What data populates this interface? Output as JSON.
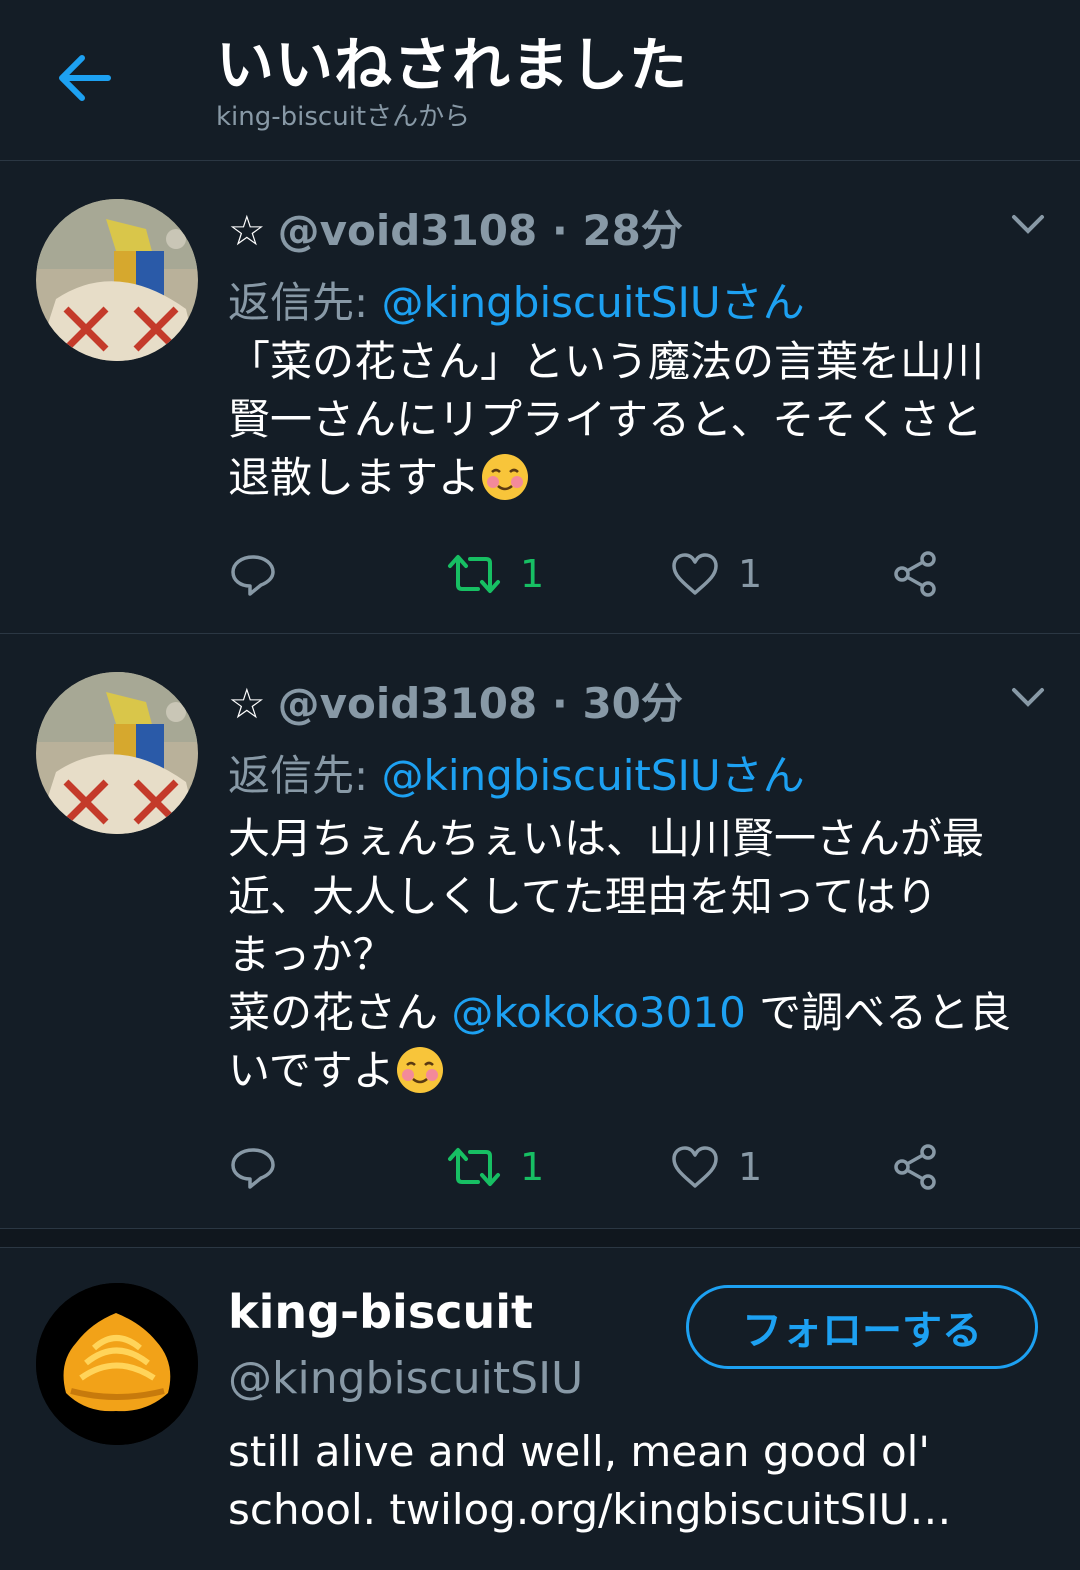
{
  "header": {
    "title": "いいねされました",
    "subtitle": "king-biscuitさんから",
    "back_icon": "arrow-left-icon"
  },
  "colors": {
    "background": "#141d26",
    "accent": "#1da1f2",
    "retweet_green": "#17bf63",
    "muted": "#8899a6"
  },
  "tweets": [
    {
      "star": "☆",
      "handle_time": "@void3108 · 28分",
      "reply_prefix": "返信先: ",
      "reply_target": "@kingbiscuitSIUさん",
      "text_lines": [
        "「菜の花さん」という魔法の言葉を山川",
        "賢一さんにリプライすると、そそくさと",
        "退散しますよ"
      ],
      "emoji": "smiling-face-icon",
      "retweets": "1",
      "likes": "1"
    },
    {
      "star": "☆",
      "handle_time": "@void3108 · 30分",
      "reply_prefix": "返信先: ",
      "reply_target": "@kingbiscuitSIUさん",
      "text_lines": [
        "大月ちぇんちぇいは、山川賢一さんが最",
        "近、大人しくしてた理由を知ってはり",
        "まっか？"
      ],
      "text_mention_before": "菜の花さん ",
      "text_mention": "@kokoko3010",
      "text_mention_after": " で調べると良",
      "text_last": "いですよ",
      "emoji": "smiling-face-icon",
      "retweets": "1",
      "likes": "1"
    }
  ],
  "user": {
    "name": "king-biscuit",
    "handle": "@kingbiscuitSIU",
    "follow_label": "フォローする",
    "bio_line1": "still alive and well, mean good ol'",
    "bio_line2": "school.  twilog.org/kingbiscuitSIU…"
  }
}
